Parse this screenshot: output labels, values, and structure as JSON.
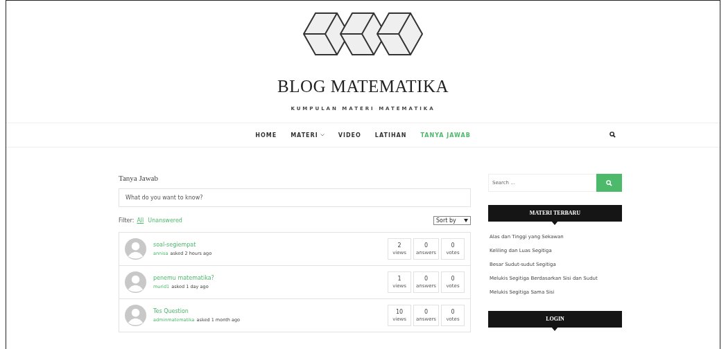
{
  "site": {
    "title": "BLOG MATEMATIKA",
    "tagline": "KUMPULAN MATERI MATEMATIKA"
  },
  "nav": {
    "items": [
      {
        "label": "HOME",
        "selected": false,
        "dropdown": false
      },
      {
        "label": "MATERI",
        "selected": false,
        "dropdown": true
      },
      {
        "label": "VIDEO",
        "selected": false,
        "dropdown": false
      },
      {
        "label": "LATIHAN",
        "selected": false,
        "dropdown": false
      },
      {
        "label": "TANYA JAWAB",
        "selected": true,
        "dropdown": false
      }
    ]
  },
  "main": {
    "heading": "Tanya Jawab",
    "ask": {
      "placeholder": "What do you want to know?"
    },
    "filter": {
      "label": "Filter:",
      "options": [
        {
          "label": "All",
          "selected": true
        },
        {
          "label": "Unanswered",
          "selected": false
        }
      ]
    },
    "sort": {
      "value": "Sort by"
    },
    "questions": [
      {
        "title": "soal-segiempat",
        "user": "annisa",
        "when": "asked 2 hours ago",
        "stats": [
          {
            "value": "2",
            "label": "views"
          },
          {
            "value": "0",
            "label": "answers"
          },
          {
            "value": "0",
            "label": "votes"
          }
        ]
      },
      {
        "title": "penemu matematika?",
        "user": "murid1",
        "when": "asked 1 day ago",
        "stats": [
          {
            "value": "1",
            "label": "views"
          },
          {
            "value": "0",
            "label": "answers"
          },
          {
            "value": "0",
            "label": "votes"
          }
        ]
      },
      {
        "title": "Tes Question",
        "user": "adminmatematika",
        "when": "asked 1 month ago",
        "stats": [
          {
            "value": "10",
            "label": "views"
          },
          {
            "value": "0",
            "label": "answers"
          },
          {
            "value": "0",
            "label": "votes"
          }
        ]
      }
    ]
  },
  "sidebar": {
    "search": {
      "placeholder": "Search ..."
    },
    "widgets": [
      {
        "title": "MATERI TERBARU",
        "links": [
          "Alas dan Tinggi yang Sekawan",
          "Keliling dan Luas Segitiga",
          "Besar Sudut-sudut Segitiga",
          "Melukis Segitiga Berdasarkan Sisi dan Sudut",
          "Melukis Segitiga Sama Sisi"
        ]
      },
      {
        "title": "LOGIN"
      }
    ]
  }
}
